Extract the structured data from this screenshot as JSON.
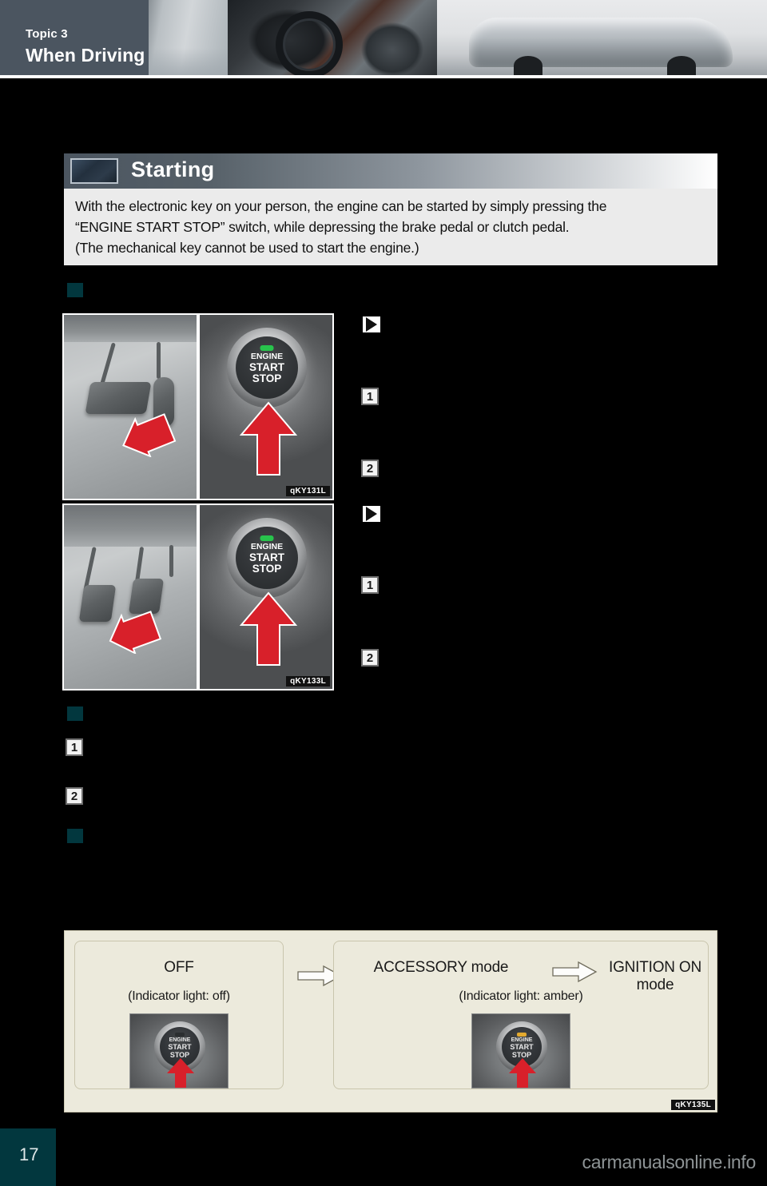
{
  "header": {
    "topic_label": "Topic 3",
    "section_title": "When Driving",
    "photo_strip": [
      "door-photo",
      "interior-photo",
      "exterior-car-photo"
    ]
  },
  "section": {
    "icon": "section-thumbnail-icon",
    "title": "Starting",
    "intro_lines": [
      "With the electronic key on your person, the engine can be started by simply pressing the",
      "“ENGINE START STOP” switch, while depressing the brake pedal or clutch pedal.",
      "(The mechanical key cannot be used to start the engine.)"
    ]
  },
  "figures": {
    "automatic": {
      "code": "qKY131L",
      "button_line1": "ENGINE",
      "button_line2": "START",
      "button_line3": "STOP",
      "indicator": "green"
    },
    "manual": {
      "code": "qKY133L",
      "button_line1": "ENGINE",
      "button_line2": "START",
      "button_line3": "STOP",
      "indicator": "green"
    }
  },
  "markers": {
    "bullet_square": "teal-square-bullet",
    "arrow_bullet": "black-triangle-bullet",
    "step_1": "1",
    "step_2": "2"
  },
  "mode_diagram": {
    "code": "qKY135L",
    "off": {
      "title": "OFF",
      "subtitle": "(Indicator light: off)",
      "button_line1": "ENGINE",
      "button_line2": "START",
      "button_line3": "STOP",
      "indicator": "off"
    },
    "on": {
      "accessory_title": "ACCESSORY mode",
      "ignition_title": "IGNITION ON mode",
      "subtitle": "(Indicator light: amber)",
      "button_line1": "ENGINE",
      "button_line2": "START",
      "button_line3": "STOP",
      "indicator": "amber"
    },
    "arrow_1": "right-arrow-icon",
    "arrow_2": "right-arrow-icon"
  },
  "footer": {
    "page_number": "17",
    "watermark": "carmanualsonline.info"
  },
  "colors": {
    "teal": "#02373e",
    "header_tab": "#4b5560",
    "banner_dark": "#4b5560",
    "intro_bg": "#ebebeb",
    "mode_bg": "#eceadc",
    "red_arrow": "#d8202a"
  }
}
